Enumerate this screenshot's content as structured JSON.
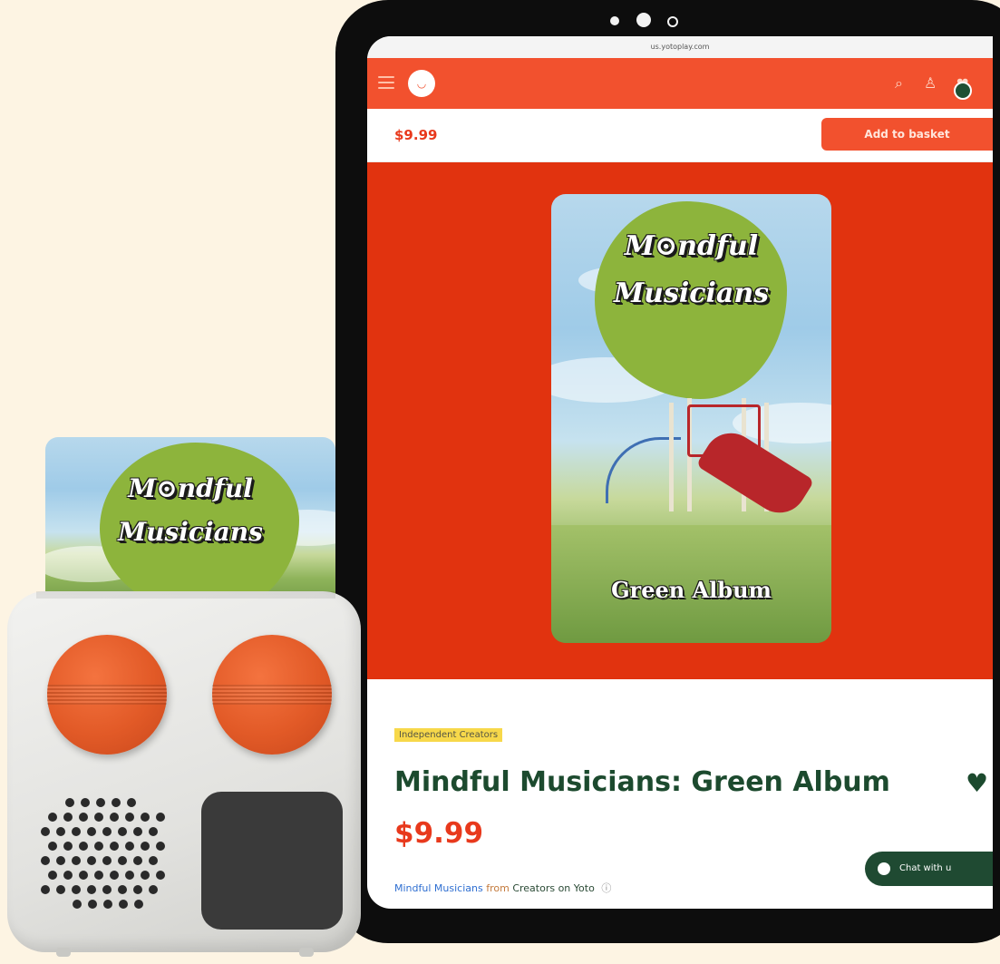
{
  "browser": {
    "url": "us.yotoplay.com"
  },
  "header": {
    "logo": "◡",
    "icons": [
      "menu-icon",
      "search-icon",
      "user-icon",
      "cart-icon"
    ]
  },
  "sticky_bar": {
    "price": "$9.99",
    "add_to_basket_label": "Add to basket"
  },
  "card_art": {
    "title_line1": "M⊙ndful",
    "title_line2": "Musicians",
    "subtitle": "Green Album"
  },
  "product": {
    "tag": "Independent Creators",
    "title": "Mindful Musicians: Green Album",
    "price": "$9.99",
    "creator": "Mindful Musicians",
    "from_word": "from",
    "source": "Creators on Yoto",
    "info_glyph": "ⓘ"
  },
  "chat": {
    "label": "Chat with u"
  },
  "colors": {
    "brand_orange": "#f2512e",
    "hero_red": "#e1330f",
    "title_green": "#1c4a2e",
    "price_red": "#e8391c",
    "knob_orange": "#e25a27"
  }
}
